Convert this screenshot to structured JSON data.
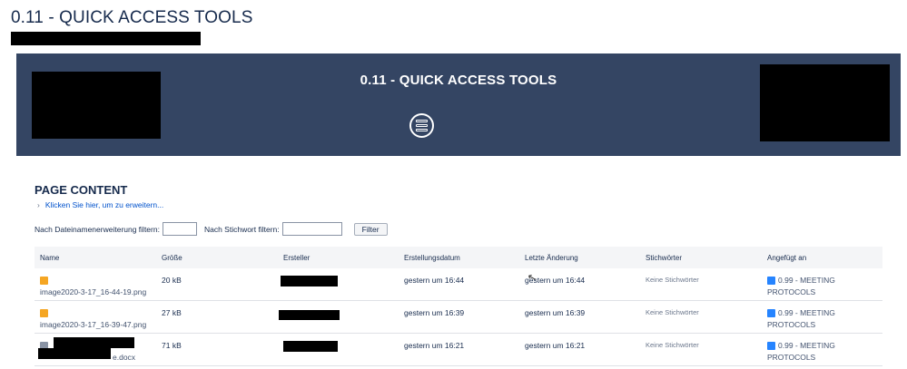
{
  "page": {
    "title": "0.11 - QUICK ACCESS TOOLS"
  },
  "banner": {
    "title": "0.11 - QUICK ACCESS TOOLS",
    "icon": "list-circle-icon"
  },
  "content": {
    "section_title": "PAGE CONTENT",
    "expand_link": "Klicken Sie hier, um zu erweitern..."
  },
  "filters": {
    "extension_label": "Nach Dateinamenerweiterung filtern:",
    "extension_value": "",
    "keyword_label": "Nach Stichwort filtern:",
    "keyword_value": "",
    "button_label": "Filter"
  },
  "table": {
    "headers": [
      "Name",
      "Größe",
      "Ersteller",
      "Erstellungsdatum",
      "Letzte Änderung",
      "Stichwörter",
      "Angefügt an"
    ],
    "rows": [
      {
        "icon": "image-file-icon",
        "name": "image2020-3-17_16-44-19.png",
        "size": "20 kB",
        "created": "gestern um 16:44",
        "modified": "gestern um 16:44",
        "keywords": "Keine Stichwörter",
        "attached_to": "0.99 - MEETING PROTOCOLS"
      },
      {
        "icon": "image-file-icon",
        "name": "image2020-3-17_16-39-47.png",
        "size": "27 kB",
        "created": "gestern um 16:39",
        "modified": "gestern um 16:39",
        "keywords": "Keine Stichwörter",
        "attached_to": "0.99 - MEETING PROTOCOLS"
      },
      {
        "icon": "document-file-icon",
        "name": "e.docx",
        "size": "71 kB",
        "created": "gestern um 16:21",
        "modified": "gestern um 16:21",
        "keywords": "Keine Stichwörter",
        "attached_to": "0.99 - MEETING PROTOCOLS"
      }
    ]
  },
  "colors": {
    "banner": "#344563",
    "link": "#0052cc",
    "image_icon": "#f5a623",
    "page_icon": "#2684ff"
  }
}
